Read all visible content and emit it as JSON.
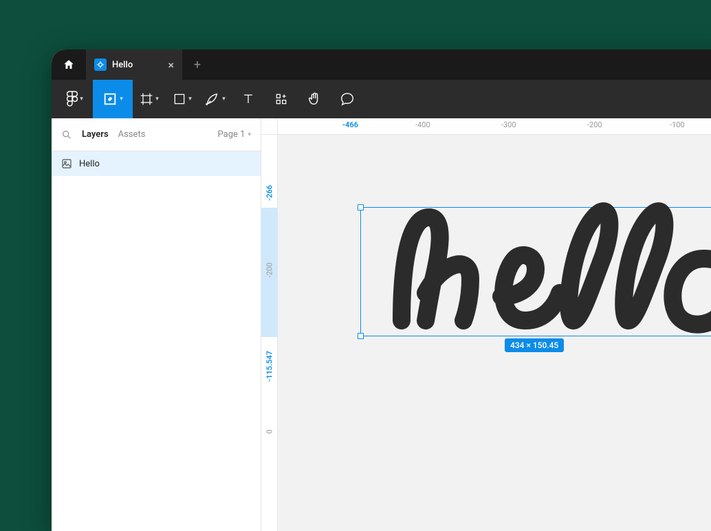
{
  "tab": {
    "title": "Hello"
  },
  "leftpanel": {
    "layers_tab": "Layers",
    "assets_tab": "Assets",
    "page_label": "Page 1",
    "layer_name": "Hello"
  },
  "ruler_h": {
    "t0": "-466",
    "t1": "-400",
    "t2": "-300",
    "t3": "-200",
    "t4": "-100"
  },
  "ruler_v": {
    "t0": "-266",
    "t1": "-200",
    "t2": "-115.547",
    "t3": "0"
  },
  "selection": {
    "dimensions": "434 × 150.45"
  }
}
